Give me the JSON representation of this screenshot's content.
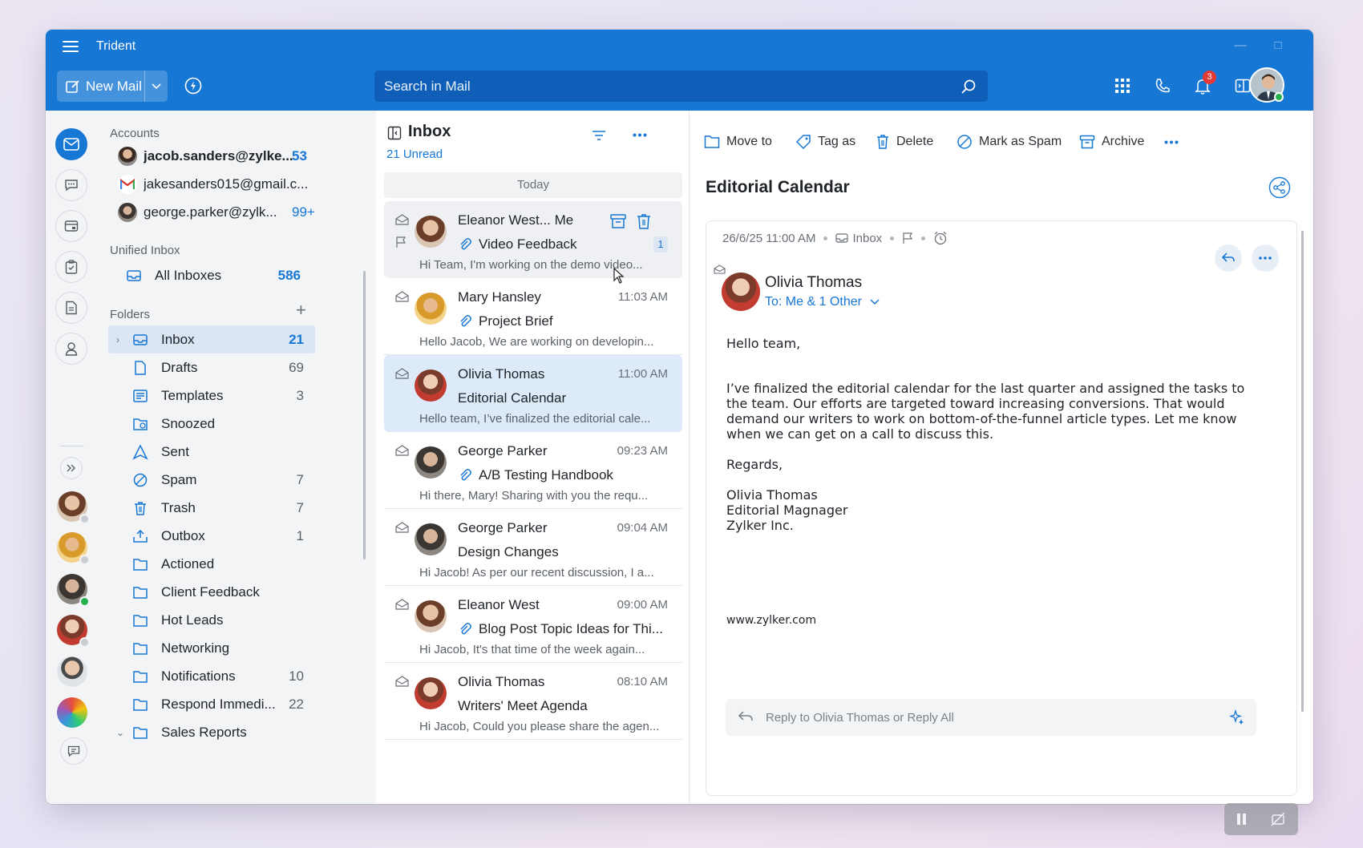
{
  "app": {
    "title": "Trident"
  },
  "toolbar": {
    "new_mail_label": "New Mail",
    "search_placeholder": "Search in Mail",
    "notification_count": "3"
  },
  "accounts_section": {
    "heading": "Accounts",
    "items": [
      {
        "email": "jacob.sanders@zylke...",
        "count": "53"
      },
      {
        "email": "jakesanders015@gmail.c...",
        "count": ""
      },
      {
        "email": "george.parker@zylk...",
        "count": "99+"
      }
    ]
  },
  "unified_section": {
    "heading": "Unified Inbox",
    "all_inboxes": {
      "label": "All Inboxes",
      "count": "586"
    }
  },
  "folders_section": {
    "heading": "Folders",
    "items": [
      {
        "label": "Inbox",
        "count": "21"
      },
      {
        "label": "Drafts",
        "count": "69"
      },
      {
        "label": "Templates",
        "count": "3"
      },
      {
        "label": "Snoozed",
        "count": ""
      },
      {
        "label": "Sent",
        "count": ""
      },
      {
        "label": "Spam",
        "count": "7"
      },
      {
        "label": "Trash",
        "count": "7"
      },
      {
        "label": "Outbox",
        "count": "1"
      },
      {
        "label": "Actioned",
        "count": ""
      },
      {
        "label": "Client Feedback",
        "count": ""
      },
      {
        "label": "Hot Leads",
        "count": ""
      },
      {
        "label": "Networking",
        "count": ""
      },
      {
        "label": "Notifications",
        "count": "10"
      },
      {
        "label": "Respond Immedi...",
        "count": "22"
      },
      {
        "label": "Sales Reports",
        "count": ""
      }
    ]
  },
  "mail_list": {
    "title": "Inbox",
    "unread": "21 Unread",
    "date_group": "Today",
    "messages": [
      {
        "from": "Eleanor West... Me",
        "time": "",
        "subject": "Video Feedback",
        "preview": "Hi Team, I'm working on the demo video...",
        "thread_count": "1"
      },
      {
        "from": "Mary Hansley",
        "time": "11:03 AM",
        "subject": "Project Brief",
        "preview": "Hello Jacob, We are working on developin..."
      },
      {
        "from": "Olivia Thomas",
        "time": "11:00 AM",
        "subject": "Editorial Calendar",
        "preview": "Hello team, I’ve finalized the editorial cale..."
      },
      {
        "from": "George Parker",
        "time": "09:23 AM",
        "subject": "A/B Testing Handbook",
        "preview": "Hi there, Mary! Sharing with you the requ..."
      },
      {
        "from": "George Parker",
        "time": "09:04 AM",
        "subject": "Design Changes",
        "preview": "Hi Jacob! As per our recent discussion, I a..."
      },
      {
        "from": "Eleanor West",
        "time": "09:00 AM",
        "subject": "Blog Post Topic Ideas for Thi...",
        "preview": "Hi Jacob, It's that time of the week again..."
      },
      {
        "from": "Olivia Thomas",
        "time": "08:10 AM",
        "subject": "Writers' Meet Agenda",
        "preview": "Hi Jacob, Could you please share the agen..."
      }
    ]
  },
  "reader": {
    "actions": {
      "move": "Move to",
      "tag": "Tag as",
      "delete": "Delete",
      "spam": "Mark as Spam",
      "archive": "Archive"
    },
    "subject": "Editorial Calendar",
    "datetime": "26/6/25 11:00 AM",
    "folder": "Inbox",
    "sender": "Olivia Thomas",
    "recipients": "To: Me & 1 Other",
    "greeting": "Hello team,",
    "paragraph": "I’ve finalized the editorial calendar for the last quarter and assigned the tasks to the team. Our efforts are targeted toward increasing conversions. That would demand our writers to work on bottom-of-the-funnel article types. Let me know when we can get on a call to discuss this.",
    "closing": "Regards,",
    "sig_name": "Olivia Thomas",
    "sig_title": "Editorial Magnager",
    "sig_company": "Zylker Inc.",
    "url": "www.zylker.com",
    "reply_prompt": "Reply to Olivia Thomas or Reply All"
  },
  "colors": {
    "accent": "#1677d4",
    "selected_row": "#dceaf9",
    "notification": "#e53935",
    "online": "#22b14c"
  }
}
